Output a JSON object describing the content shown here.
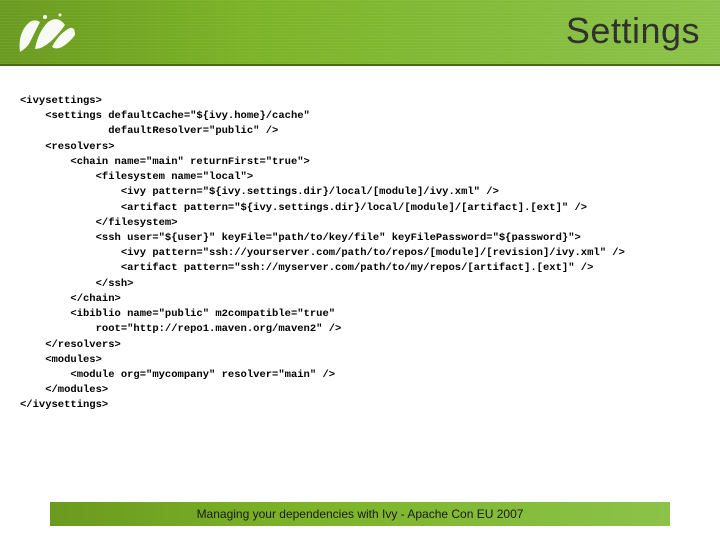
{
  "header": {
    "title": "Settings"
  },
  "code": {
    "line1": "<ivysettings>",
    "line2": "    <settings defaultCache=\"${ivy.home}/cache\"",
    "line3": "              defaultResolver=\"public\" />",
    "line4": "    <resolvers>",
    "line5": "        <chain name=\"main\" returnFirst=\"true\">",
    "line6": "            <filesystem name=\"local\">",
    "line7": "                <ivy pattern=\"${ivy.settings.dir}/local/[module]/ivy.xml\" />",
    "line8": "                <artifact pattern=\"${ivy.settings.dir}/local/[module]/[artifact].[ext]\" />",
    "line9": "            </filesystem>",
    "line10": "            <ssh user=\"${user}\" keyFile=\"path/to/key/file\" keyFilePassword=\"${password}\">",
    "line11": "                <ivy pattern=\"ssh://yourserver.com/path/to/repos/[module]/[revision]/ivy.xml\" />",
    "line12": "                <artifact pattern=\"ssh://myserver.com/path/to/my/repos/[artifact].[ext]\" />",
    "line13": "            </ssh>",
    "line14": "        </chain>",
    "line15": "        <ibiblio name=\"public\" m2compatible=\"true\"",
    "line16": "            root=\"http://repo1.maven.org/maven2\" />",
    "line17": "    </resolvers>",
    "line18": "    <modules>",
    "line19": "        <module org=\"mycompany\" resolver=\"main\" />",
    "line20": "    </modules>",
    "line21": "</ivysettings>"
  },
  "footer": {
    "text": "Managing your dependencies with Ivy - Apache Con EU 2007"
  }
}
